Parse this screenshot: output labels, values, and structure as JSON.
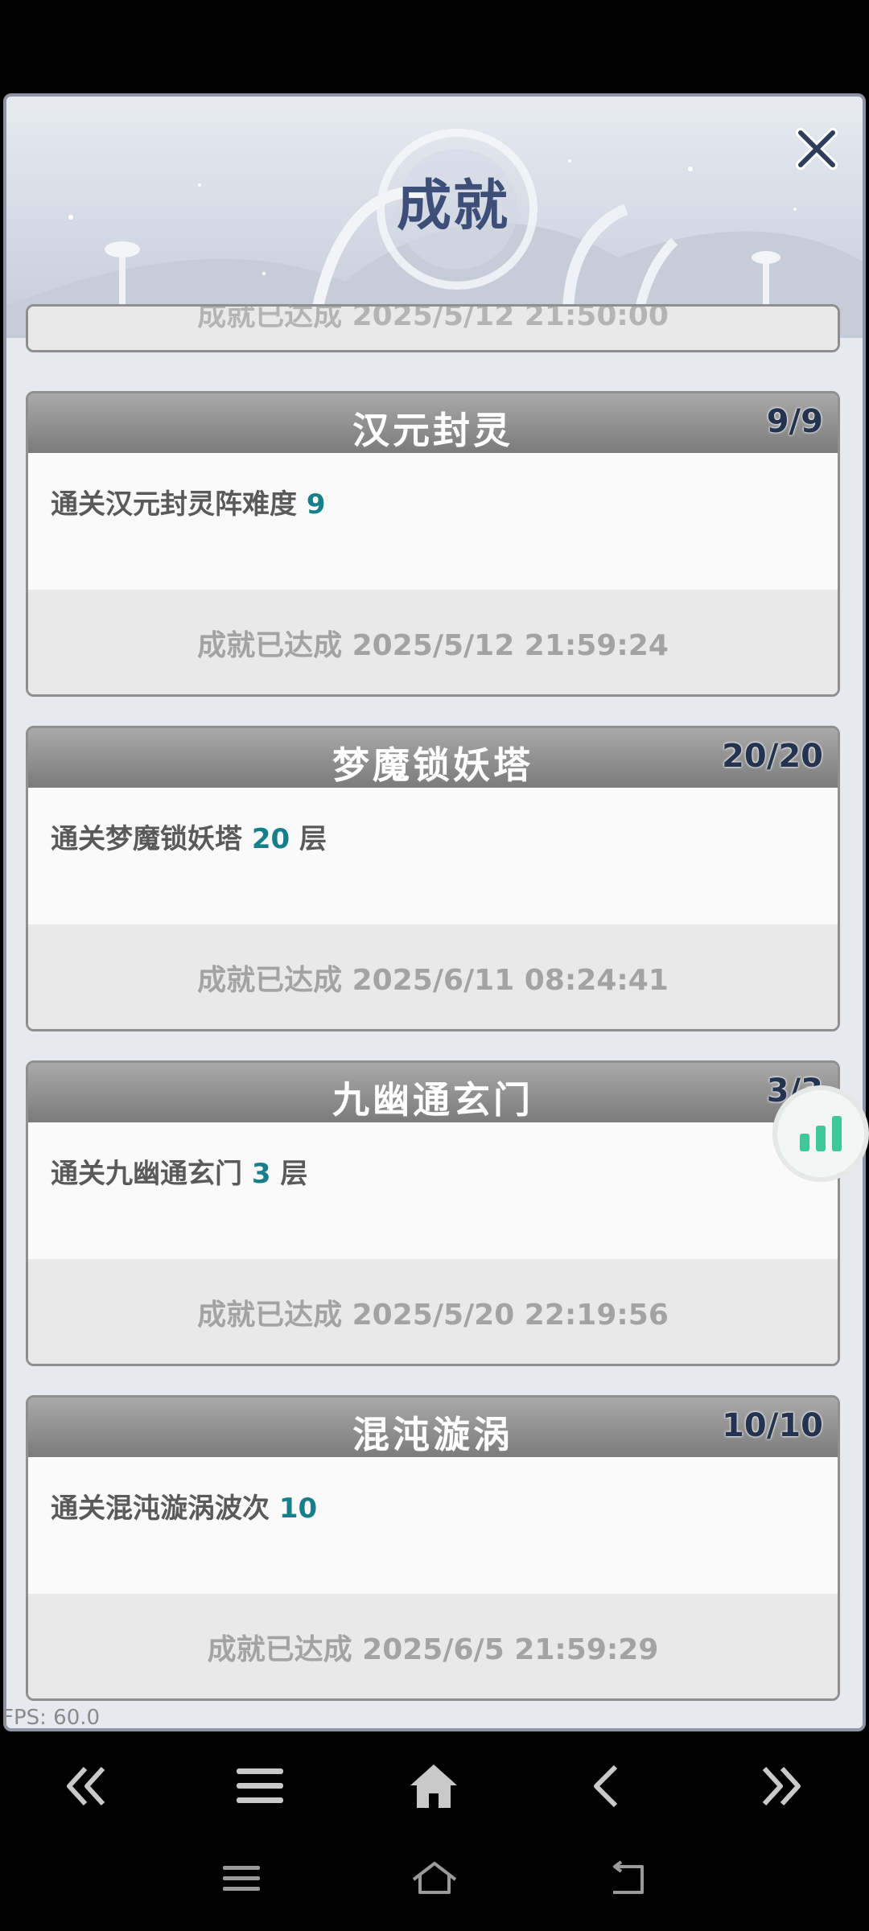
{
  "header": {
    "title": "成就"
  },
  "partial_top": {
    "status": "成就已达成  2025/5/12 21:50:00"
  },
  "cards": [
    {
      "name": "汉元封灵",
      "count": "9/9",
      "desc_prefix": "通关汉元封灵阵难度 ",
      "desc_value": "9",
      "desc_suffix": "",
      "status": "成就已达成   2025/5/12 21:59:24"
    },
    {
      "name": "梦魔锁妖塔",
      "count": "20/20",
      "desc_prefix": "通关梦魔锁妖塔 ",
      "desc_value": "20",
      "desc_suffix": " 层",
      "status": "成就已达成   2025/6/11 08:24:41"
    },
    {
      "name": "九幽通玄门",
      "count": "3/3",
      "desc_prefix": "通关九幽通玄门 ",
      "desc_value": "3",
      "desc_suffix": " 层",
      "status": "成就已达成   2025/5/20 22:19:56"
    },
    {
      "name": "混沌漩涡",
      "count": "10/10",
      "desc_prefix": "通关混沌漩涡波次 ",
      "desc_value": "10",
      "desc_suffix": "",
      "status": "成就已达成   2025/6/5 21:59:29"
    }
  ],
  "fps": "FPS: 60.0",
  "nav": [
    "double-left-icon",
    "menu-icon",
    "home-icon",
    "back-icon",
    "double-right-icon"
  ],
  "system_nav": [
    "recent-apps-icon",
    "home-outline-icon",
    "back-arrow-icon"
  ],
  "colors": {
    "accent": "#187f8a",
    "title": "#3d4f78",
    "card_header": "#8a8a8a"
  }
}
